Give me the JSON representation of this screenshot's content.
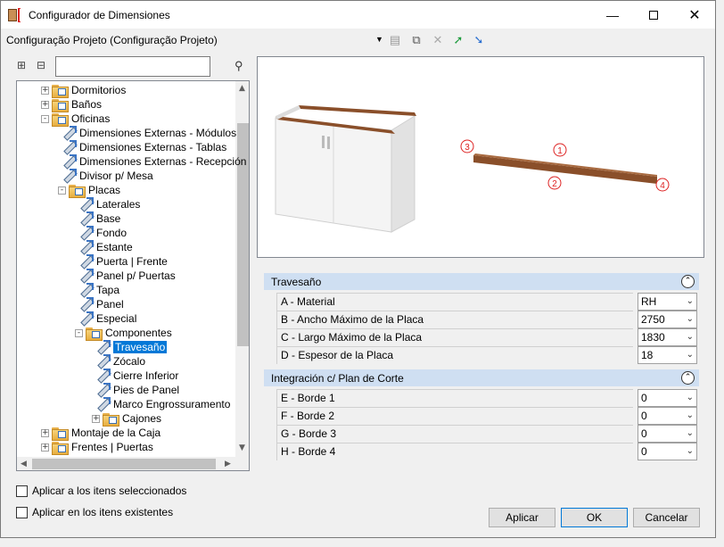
{
  "window": {
    "title": "Configurador de Dimensiones",
    "min_icon": "minimize-icon",
    "max_icon": "maximize-icon",
    "close_icon": "close-icon"
  },
  "config": {
    "selected": "Configuração Projeto (Configuração Projeto)"
  },
  "tree": {
    "items": [
      {
        "label": "Dormitorios",
        "type": "folder",
        "expander": "+"
      },
      {
        "label": "Baños",
        "type": "folder",
        "expander": "+"
      },
      {
        "label": "Oficinas",
        "type": "folder",
        "expander": "-"
      },
      {
        "label": "Dimensiones Externas - Módulos",
        "type": "item"
      },
      {
        "label": "Dimensiones Externas - Tablas",
        "type": "item"
      },
      {
        "label": "Dimensiones Externas - Recepción",
        "type": "item"
      },
      {
        "label": "Divisor p/ Mesa",
        "type": "item"
      },
      {
        "label": "Placas",
        "type": "folder",
        "expander": "-"
      },
      {
        "label": "Laterales",
        "type": "item"
      },
      {
        "label": "Base",
        "type": "item"
      },
      {
        "label": "Fondo",
        "type": "item"
      },
      {
        "label": "Estante",
        "type": "item"
      },
      {
        "label": "Puerta | Frente",
        "type": "item"
      },
      {
        "label": "Panel p/ Puertas",
        "type": "item"
      },
      {
        "label": "Tapa",
        "type": "item"
      },
      {
        "label": "Panel",
        "type": "item"
      },
      {
        "label": "Especial",
        "type": "item"
      },
      {
        "label": "Componentes",
        "type": "folder",
        "expander": "-"
      },
      {
        "label": "Travesaño",
        "type": "item",
        "selected": true
      },
      {
        "label": "Zócalo",
        "type": "item"
      },
      {
        "label": "Cierre Inferior",
        "type": "item"
      },
      {
        "label": "Pies de Panel",
        "type": "item"
      },
      {
        "label": "Marco Engrossuramento",
        "type": "item"
      },
      {
        "label": "Cajones",
        "type": "folder",
        "expander": "+"
      },
      {
        "label": "Montaje de la Caja",
        "type": "folder",
        "expander": "+"
      },
      {
        "label": "Frentes | Puertas",
        "type": "folder",
        "expander": "+"
      }
    ]
  },
  "preview": {
    "markers": [
      "1",
      "2",
      "3",
      "4"
    ]
  },
  "sections": [
    {
      "title": "Travesaño",
      "rows": [
        {
          "name": "A - Material",
          "value": "RH"
        },
        {
          "name": "B -  Ancho Máximo de la Placa",
          "value": "2750"
        },
        {
          "name": "C - Largo Máximo de la Placa",
          "value": "1830"
        },
        {
          "name": "D - Espesor de la Placa",
          "value": "18"
        }
      ]
    },
    {
      "title": "Integración c/ Plan de Corte",
      "rows": [
        {
          "name": "E - Borde 1",
          "value": "0"
        },
        {
          "name": "F - Borde 2",
          "value": "0"
        },
        {
          "name": "G - Borde 3",
          "value": "0"
        },
        {
          "name": "H - Borde 4",
          "value": "0"
        }
      ]
    }
  ],
  "options": {
    "apply_selected": "Aplicar a los itens seleccionados",
    "apply_existing": "Aplicar en los itens existentes"
  },
  "buttons": {
    "apply": "Aplicar",
    "ok": "OK",
    "cancel": "Cancelar"
  },
  "colors": {
    "selection": "#0078d7",
    "section_header": "#cfdff2",
    "wood": "#8a4f2a"
  }
}
